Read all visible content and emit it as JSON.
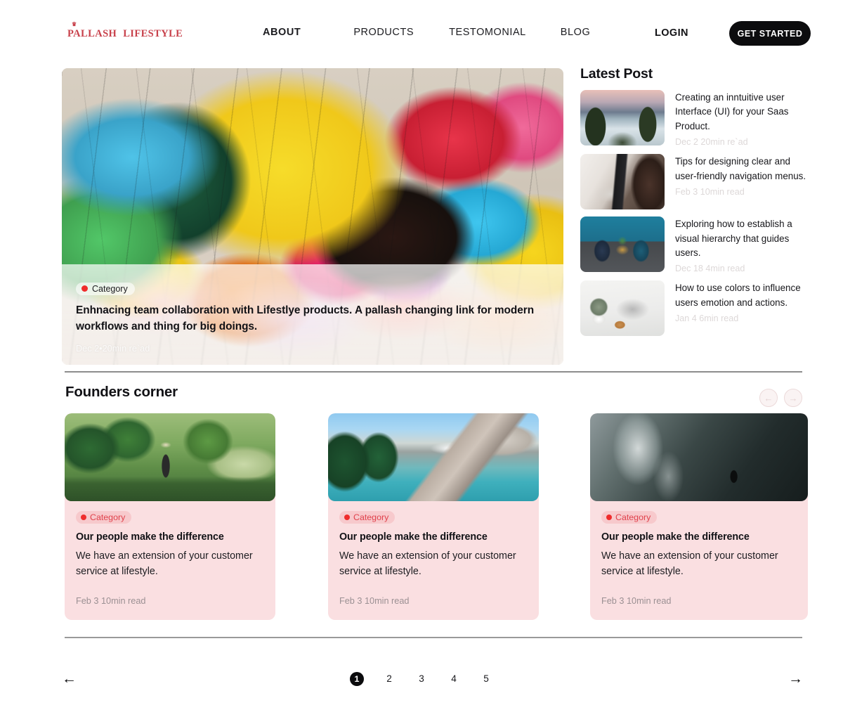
{
  "header": {
    "logo": {
      "crown_icon": "crown-icon",
      "brand": "PALLASH",
      "brand2": "LIFESTYLE"
    },
    "nav": [
      {
        "label": "ABOUT",
        "active": true
      },
      {
        "label": "PRODUCTS",
        "active": false
      },
      {
        "label": "TESTOMONIAL",
        "active": false
      },
      {
        "label": "BLOG",
        "active": false
      }
    ],
    "login_label": "LOGIN",
    "cta_label": "GET STARTED"
  },
  "hero": {
    "category_label": "Category",
    "title": "Enhnacing team collaboration with Lifestlye products. A pallash changing link for modern workflows and thing for big doings.",
    "meta": "Dec 2•20min re`ad"
  },
  "latest": {
    "title": "Latest Post",
    "posts": [
      {
        "title": "Creating an inntuitive user Interface (UI) for your Saas Product.",
        "meta": "Dec 2 20min re`ad"
      },
      {
        "title": "Tips for designing clear and user-friendly navigation menus.",
        "meta": "Feb 3 10min read"
      },
      {
        "title": "Exploring how to establish a visual hierarchy that guides users.",
        "meta": "Dec 18 4min read"
      },
      {
        "title": "How to use colors to influence users emotion and actions.",
        "meta": "Jan 4 6min read"
      }
    ]
  },
  "founders": {
    "title": "Founders corner",
    "prev_icon": "arrow-left-icon",
    "next_icon": "arrow-right-icon",
    "cards": [
      {
        "category_label": "Category",
        "title": "Our people make the difference",
        "desc": "We have an extension of your customer service at lifestyle.",
        "meta": "Feb 3 10min read"
      },
      {
        "category_label": "Category",
        "title": "Our people make the difference",
        "desc": "We have an extension of your customer service at lifestyle.",
        "meta": "Feb 3 10min read"
      },
      {
        "category_label": "Category",
        "title": "Our people make the difference",
        "desc": "We have an extension of your customer service at lifestyle.",
        "meta": "Feb 3 10min read"
      }
    ]
  },
  "pagination": {
    "prev_icon": "←",
    "next_icon": "→",
    "pages": [
      "1",
      "2",
      "3",
      "4",
      "5"
    ],
    "current": "1"
  },
  "colors": {
    "accent_red": "#ef2c2c",
    "brand_red": "#c8414b",
    "card_pink": "#fadfe1",
    "badge_pink": "#f7c9cc",
    "black": "#0c0c0e"
  }
}
